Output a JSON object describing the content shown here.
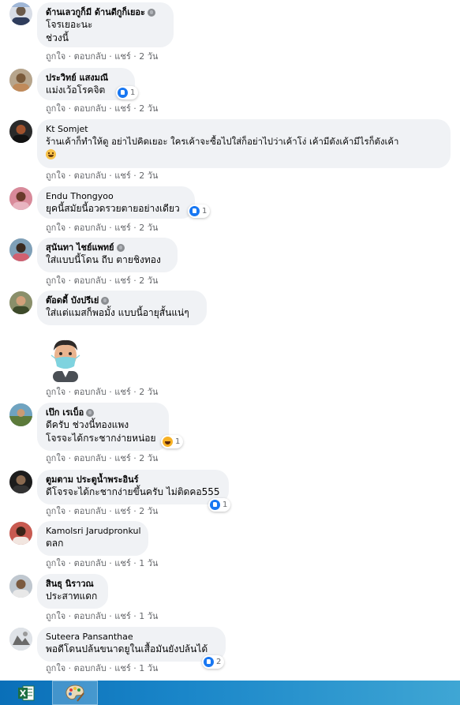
{
  "actions": {
    "like": "ถูกใจ",
    "reply": "ตอบกลับ",
    "share": "แชร์",
    "sep": "·"
  },
  "comments": [
    {
      "name": "ด้านเลวกูก็มี ด้านดีกูก็เยอะ",
      "lines": [
        "โจรเยอะนะ",
        "ช่วงนี้"
      ],
      "time": "2 วัน"
    },
    {
      "name": "ประวิทย์ แสงมณี",
      "lines": [
        "แม่งเว้อโรคจิต"
      ],
      "time": "2 วัน",
      "reaction_count": "1"
    },
    {
      "name": "Kt Somjet",
      "lines": [
        "ร้านเค้าก็ทำให้ดู อย่าไปคิดเยอะ ใครเค้าจะซื้อไปใส่ก็อย่าไปว่าเค้าโง่ เค้ามีตังเค้ามีไรก็ตังเค้า"
      ],
      "time": "2 วัน"
    },
    {
      "name": "Endu Thongyoo",
      "lines": [
        "ยุคนี้สมัยนี้อวดรวยตายอย่างเดียว"
      ],
      "time": "2 วัน",
      "reaction_count": "1"
    },
    {
      "name": "สุนันทา ไชย์แพทย์",
      "lines": [
        "ใส่แบบนี้โดน ถีบ ตายชิงทอง"
      ],
      "time": "2 วัน"
    },
    {
      "name": "ต๊อดดี้ บังปรีเย่",
      "lines": [
        "ใส่แต่แมสก็พอมั้ง แบบนี้อายุสั้นแน่ๆ"
      ],
      "time": "2 วัน"
    },
    {
      "name": "เป๊ก เรเบ็อ",
      "lines": [
        "ดีครับ ช่วงนี้ทองแพง",
        "โจรจะได้กระชากง่ายหน่อย"
      ],
      "time": "2 วัน",
      "reaction_count": "1"
    },
    {
      "name": "ตูมตาม ประตูน้ำพระอินร์",
      "lines": [
        "ดีโจรจะได้กะชากง่ายขึ้นครับ ไม่ติดคอ555"
      ],
      "time": "2 วัน",
      "reaction_count": "1"
    },
    {
      "name": "Kamolsri Jarudpronkul",
      "lines": [
        "ตลก"
      ],
      "time": "1 วัน"
    },
    {
      "name": "สินธุ นิราวณ",
      "lines": [
        "ประสาทแดก"
      ],
      "time": "1 วัน"
    },
    {
      "name": "Suteera Pansanthae",
      "lines": [
        "พอดีโดนปล้นขนาดยูในเสื้อมันยังปล้นได้"
      ],
      "time": "1 วัน",
      "reaction_count": "2"
    }
  ],
  "taskbar": {
    "apps": [
      "excel-app",
      "paint-app"
    ]
  }
}
